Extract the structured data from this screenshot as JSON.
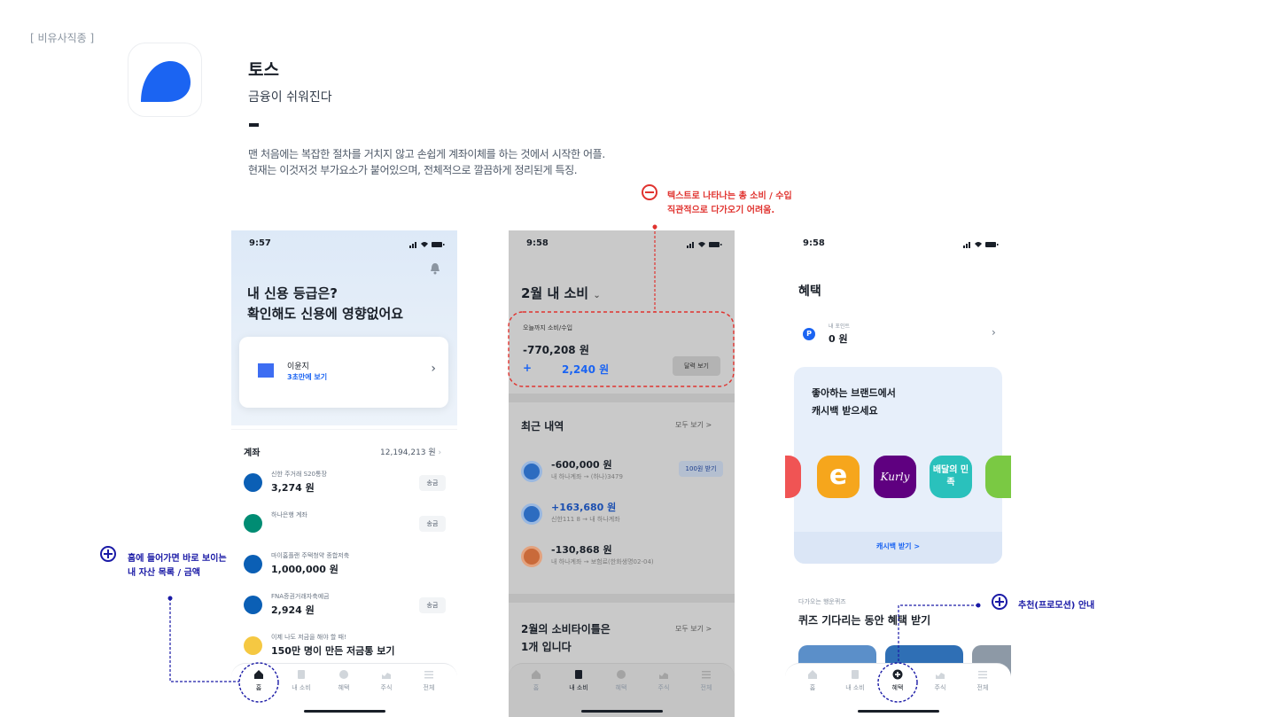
{
  "section_tag": "[ 비유사직종 ]",
  "app": {
    "name": "토스",
    "tagline": "금융이 쉬워진다",
    "desc_line1": "맨 처음에는 복잡한 절차를 거치지 않고 손쉽게 계좌이체를 하는 것에서 시작한 어플.",
    "desc_line2": "현재는 이것저것 부가요소가 붙어있으며, 전체적으로 깔끔하게 정리된게 특징.",
    "brand_color": "#1b64f2"
  },
  "annotations": {
    "minus_note_line1": "텍스트로 나타나는 총 소비 / 수입",
    "minus_note_line2": "직관적으로 다가오기 어려움.",
    "plus_note1_line1": "홈에 들어가면 바로 보이는",
    "plus_note1_line2": "내 자산 목록 / 금액",
    "plus_note2": "추천(프로모션) 안내",
    "minus_color": "#e0332f",
    "plus_color": "#1a1aa6"
  },
  "tabs": [
    "홈",
    "내 소비",
    "혜택",
    "주식",
    "전체"
  ],
  "screen1": {
    "time": "9:57",
    "headline1": "내 신용 등급은?",
    "headline2": "확인해도 신용에 영향없어요",
    "card_name": "이윤지",
    "card_sub": "3초만에 보기",
    "accounts_title": "계좌",
    "accounts_total": "12,194,213 원",
    "accounts": [
      {
        "name": "신한 주거래 S20통장",
        "amount": "3,274 원",
        "button": "송금"
      },
      {
        "name": "하나은행 계좌",
        "amount": "",
        "button": "송금"
      },
      {
        "name": "마이홈플랜 주택청약 종합저축",
        "amount": "1,000,000 원",
        "button": ""
      },
      {
        "name": "FNA증권거래자축예금",
        "amount": "2,924 원",
        "button": "송금"
      },
      {
        "name": "이제 나도 저금을 해야 할 때!",
        "amount": "150만 명이 만든 저금통 보기",
        "button": ""
      }
    ]
  },
  "screen2": {
    "time": "9:58",
    "title": "2월 내 소비",
    "summary_label": "오늘까지 소비/수입",
    "spend": "-770,208 원",
    "income_sign": "+",
    "income": "2,240 원",
    "calendar_button": "달력 보기",
    "recent_title": "최근 내역",
    "see_all": "모두 보기 >",
    "transactions": [
      {
        "amount": "-600,000 원",
        "sub": "내 하나계좌 → (하나)3479",
        "button": "100원 받기"
      },
      {
        "amount": "+163,680 원",
        "sub": "신한111     8 → 내 하나계좌",
        "button": ""
      },
      {
        "amount": "-130,868 원",
        "sub": "내 하나계좌 → 보험료(한화생명02-04)",
        "button": ""
      }
    ],
    "type_title1": "2월의 소비타이틀은",
    "type_title2": "1개 입니다",
    "type_see_all": "모두 보기 >"
  },
  "screen3": {
    "time": "9:58",
    "title": "혜택",
    "points_label": "내 포인트",
    "points_value": "0 원",
    "cashback_line1": "좋아하는 브랜드에서",
    "cashback_line2": "캐시백 받으세요",
    "brands": [
      "e",
      "Kurly",
      "배달의 민족"
    ],
    "cashback_link": "캐시백 받기 >",
    "quiz_small": "다가오는 행운퀴즈",
    "quiz_title": "퀴즈 기다리는 동안 혜택 받기"
  }
}
